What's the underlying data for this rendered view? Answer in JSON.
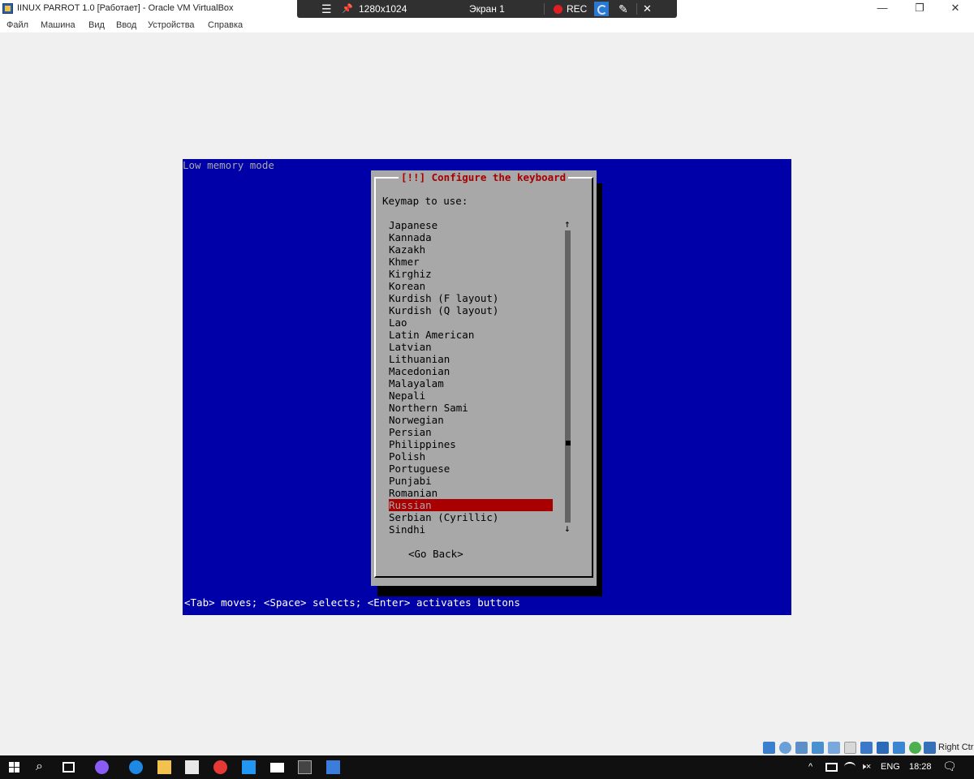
{
  "window": {
    "title": "IINUX PARROT 1.0 [Работает] - Oracle VM VirtualBox",
    "minimize_glyph": "—",
    "restore_glyph": "❐",
    "close_glyph": "✕"
  },
  "vb_toolbar": {
    "menu_glyph": "☰",
    "pin_glyph": "📌",
    "resolution": "1280x1024",
    "screen": "Экран 1",
    "rec": "REC",
    "pen_glyph": "✎",
    "close_glyph": "✕"
  },
  "menu": {
    "items": [
      "Файл",
      "Машина",
      "Вид",
      "Ввод",
      "Устройства",
      "Справка"
    ]
  },
  "vm_screen": {
    "mode_text": "Low memory mode",
    "hint_text": "<Tab> moves; <Space> selects; <Enter> activates buttons",
    "dialog": {
      "title": "[!!] Configure the keyboard",
      "prompt": "Keymap to use:",
      "items": [
        "Japanese",
        "Kannada",
        "Kazakh",
        "Khmer",
        "Kirghiz",
        "Korean",
        "Kurdish (F layout)",
        "Kurdish (Q layout)",
        "Lao",
        "Latin American",
        "Latvian",
        "Lithuanian",
        "Macedonian",
        "Malayalam",
        "Nepali",
        "Northern Sami",
        "Norwegian",
        "Persian",
        "Philippines",
        "Polish",
        "Portuguese",
        "Punjabi",
        "Romanian",
        "Russian",
        "Serbian (Cyrillic)",
        "Sindhi"
      ],
      "selected": "Russian",
      "scroll_up_glyph": "↑",
      "scroll_down_glyph": "↓",
      "go_back": "<Go Back>"
    }
  },
  "statusbar": {
    "host_key": "Right Ctrl"
  },
  "taskbar": {
    "search_glyph": "⌕",
    "tray_up_glyph": "^",
    "volume_glyph": "🕨×",
    "language": "ENG",
    "time": "18:28",
    "notification_glyph": "🗨"
  },
  "colors": {
    "vm_background": "#0000a8",
    "dialog": "#a8a8a8",
    "title_red": "#a80000",
    "selection": "#a80000"
  }
}
